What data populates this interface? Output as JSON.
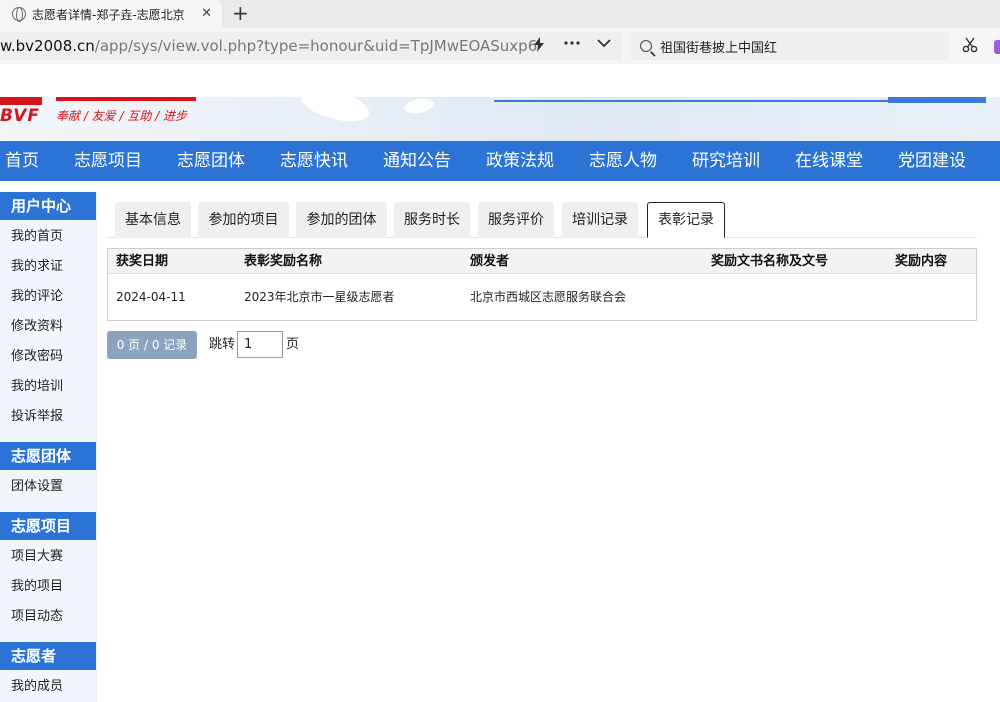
{
  "browser": {
    "tab_title": "志愿者详情-郑子垚-志愿北京",
    "close_glyph": "✕",
    "newtab_glyph": "+",
    "url_host": "w.bv2008.cn",
    "url_path": "/app/sys/view.vol.php?type=honour&uid=TpJMwEOASuxp6",
    "search_text": "祖国街巷披上中国红",
    "icons": [
      "globe-icon",
      "close-icon",
      "plus-icon",
      "lightning-icon",
      "more-icon",
      "chevron-down-icon",
      "search-icon",
      "scissors-icon"
    ]
  },
  "banner": {
    "logo_text": "BVF",
    "slogan": "奉献 / 友爱 / 互助 / 进步"
  },
  "nav": {
    "items": [
      "首页",
      "志愿项目",
      "志愿团体",
      "志愿快讯",
      "通知公告",
      "政策法规",
      "志愿人物",
      "研究培训",
      "在线课堂",
      "党团建设"
    ]
  },
  "sidebar": {
    "sections": [
      {
        "title": "用户中心",
        "items": [
          "我的首页",
          "我的求证",
          "我的评论",
          "修改资料",
          "修改密码",
          "我的培训",
          "投诉举报"
        ]
      },
      {
        "title": "志愿团体",
        "items": [
          "团体设置"
        ]
      },
      {
        "title": "志愿项目",
        "items": [
          "项目大赛",
          "我的项目",
          "项目动态"
        ]
      },
      {
        "title": "志愿者",
        "items": [
          "我的成员"
        ]
      }
    ]
  },
  "main": {
    "tabs": [
      "基本信息",
      "参加的项目",
      "参加的团体",
      "服务时长",
      "服务评价",
      "培训记录",
      "表彰记录"
    ],
    "active_tab": "表彰记录",
    "table": {
      "headers": [
        "获奖日期",
        "表彰奖励名称",
        "颁发者",
        "奖励文书名称及文号",
        "奖励内容"
      ],
      "rows": [
        [
          "2024-04-11",
          "2023年北京市一星级志愿者",
          "北京市西城区志愿服务联合会",
          "",
          ""
        ]
      ]
    },
    "pager": {
      "summary": "0 页 / 0 记录",
      "jump_label": "跳转",
      "page_value": "1",
      "page_label": "页"
    }
  }
}
